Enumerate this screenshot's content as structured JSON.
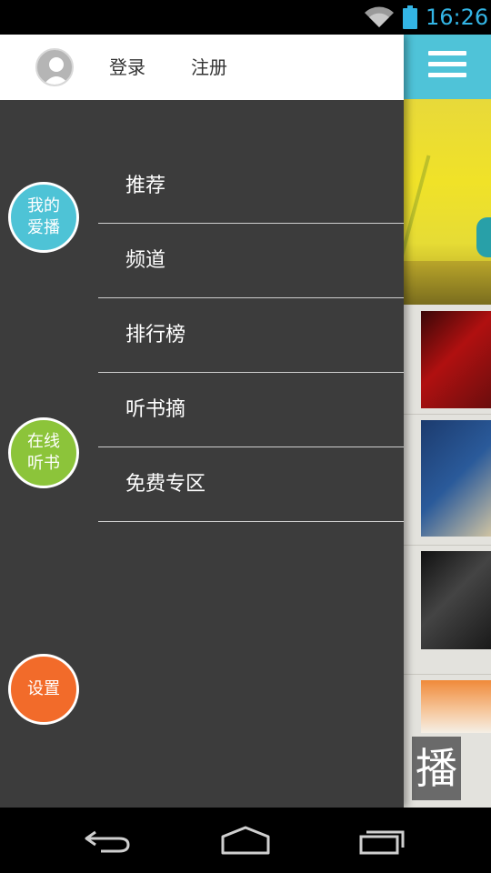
{
  "status_bar": {
    "time": "16:26",
    "icons": [
      "wifi-icon",
      "battery-icon"
    ]
  },
  "drawer": {
    "header": {
      "login_label": "登录",
      "register_label": "注册"
    },
    "menu_items": [
      {
        "label": "推荐"
      },
      {
        "label": "频道"
      },
      {
        "label": "排行榜"
      },
      {
        "label": "听书摘"
      },
      {
        "label": "免费专区"
      }
    ],
    "side_buttons": {
      "my_favorites": {
        "line1": "我的",
        "line2": "爱播"
      },
      "audiobooks": {
        "line1": "在线",
        "line2": "听书"
      },
      "settings": {
        "label": "设置"
      }
    }
  },
  "content": {
    "app_tile_char": "播"
  },
  "colors": {
    "accent": "#4fc3d8",
    "drawer_bg": "#3c3c3c",
    "green": "#8cc43a",
    "orange": "#f26b2a",
    "status_clock": "#33b5e5"
  }
}
